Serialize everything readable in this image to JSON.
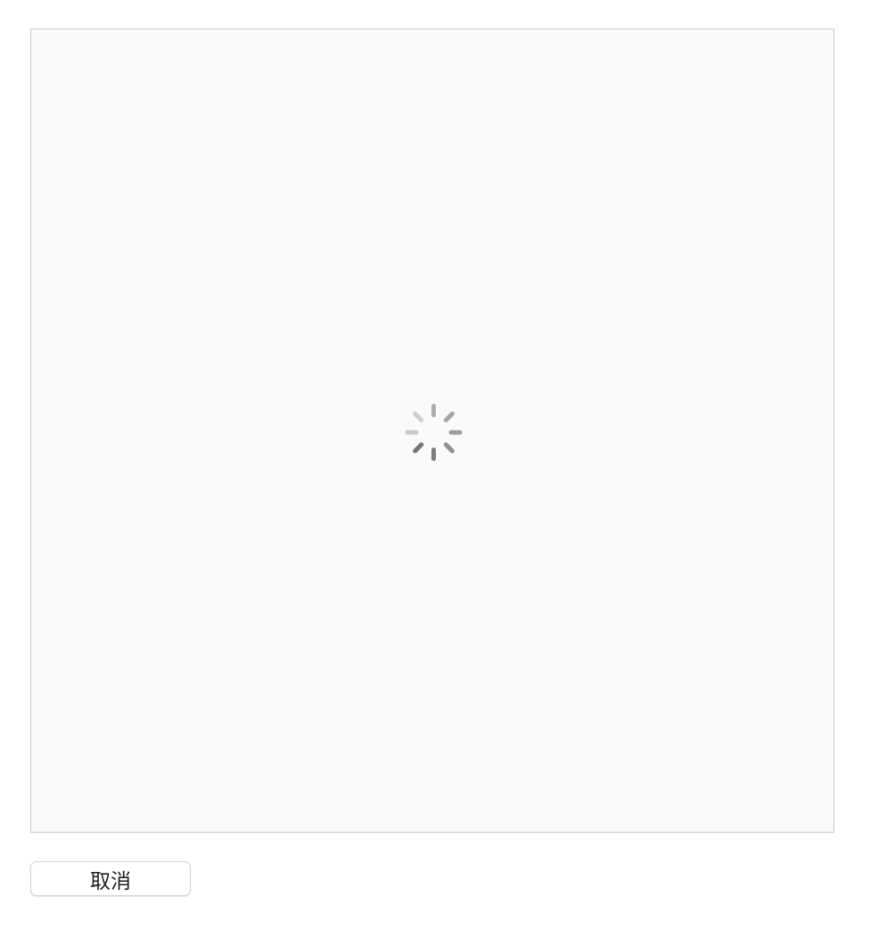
{
  "dialog": {
    "content": {
      "state": "loading",
      "spinner_icon": "loading-spinner-icon"
    },
    "cancel_label": "取消"
  },
  "colors": {
    "panel_background": "#fafafa",
    "panel_border": "#c8c8c8",
    "spinner": "#6e6e6e"
  }
}
